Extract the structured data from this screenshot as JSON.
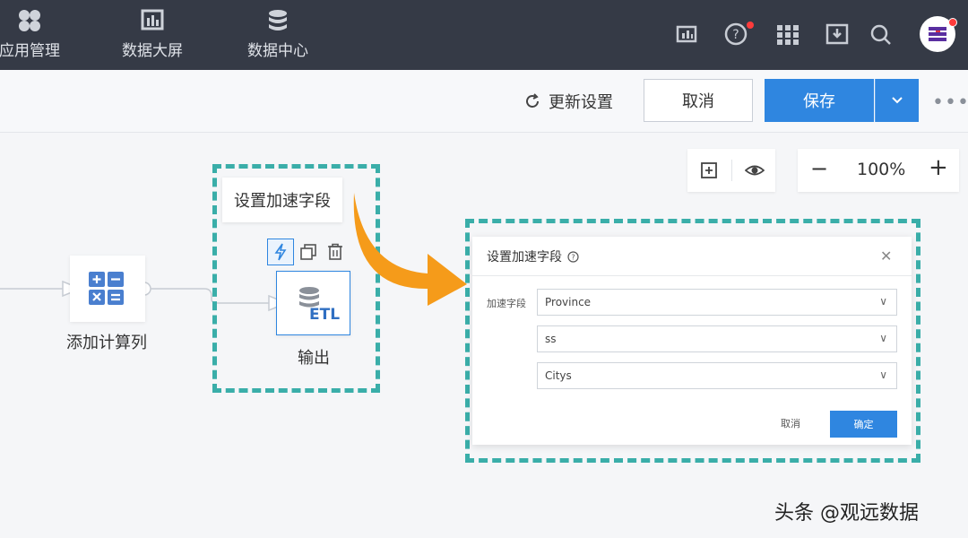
{
  "nav": {
    "items": [
      {
        "label": "应用管理",
        "icon": "apps-icon"
      },
      {
        "label": "数据大屏",
        "icon": "dashboard-icon"
      },
      {
        "label": "数据中心",
        "icon": "database-icon"
      }
    ],
    "right_icons": [
      "report-icon",
      "help-icon",
      "grid-icon",
      "inbox-icon",
      "search-icon",
      "avatar"
    ]
  },
  "toolbar": {
    "refresh_label": "更新设置",
    "cancel_label": "取消",
    "save_label": "保存"
  },
  "canvas": {
    "zoom": "100%",
    "zoom_minus": "−",
    "zoom_plus": "+",
    "calc_node_label": "添加计算列",
    "output_node_label": "输出",
    "output_node_badge": "ETL",
    "tooltip": "设置加速字段"
  },
  "dialog": {
    "title": "设置加速字段",
    "field_label": "加速字段",
    "selects": [
      "Province",
      "ss",
      "Citys"
    ],
    "cancel_label": "取消",
    "ok_label": "确定"
  },
  "watermark": "头条 @观远数据",
  "colors": {
    "nav_bg": "#353a46",
    "primary": "#2f86e0",
    "dash": "#3aaea9",
    "arrow": "#f59b1a"
  }
}
